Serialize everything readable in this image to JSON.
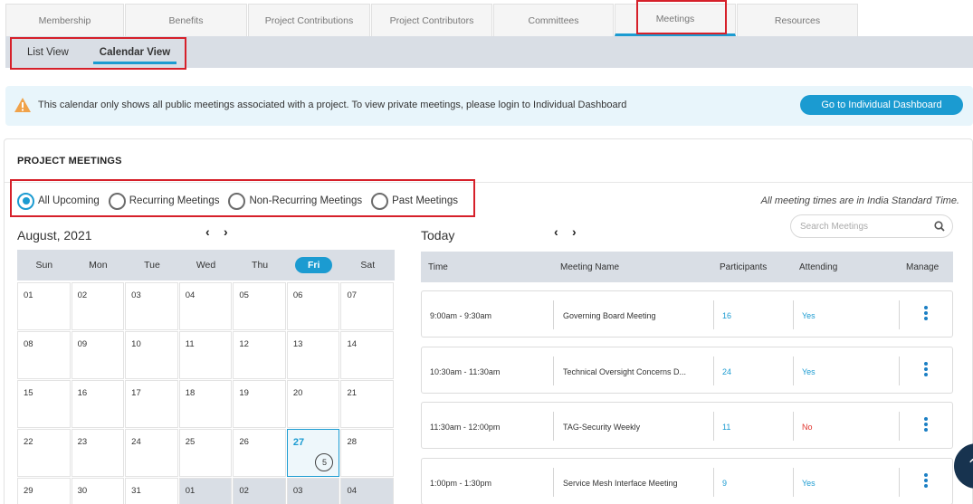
{
  "tabs": [
    "Membership",
    "Benefits",
    "Project Contributions",
    "Project Contributors",
    "Committees",
    "Meetings",
    "Resources"
  ],
  "active_tab": "Meetings",
  "subtabs": [
    "List View",
    "Calendar View"
  ],
  "active_subtab": "Calendar View",
  "alert": {
    "message": "This calendar only shows all public meetings associated with a project. To view private meetings, please login to Individual Dashboard",
    "button": "Go to Individual Dashboard"
  },
  "panel": {
    "title": "PROJECT MEETINGS",
    "filters": [
      "All Upcoming",
      "Recurring Meetings",
      "Non-Recurring Meetings",
      "Past Meetings"
    ],
    "selected_filter": "All Upcoming",
    "timezone_note": "All meeting times are in India Standard Time.",
    "search_placeholder": "Search Meetings"
  },
  "calendar": {
    "month": "August, 2021",
    "prev": "‹",
    "next": "›",
    "days": [
      "Sun",
      "Mon",
      "Tue",
      "Wed",
      "Thu",
      "Fri",
      "Sat"
    ],
    "today_day": "Fri",
    "weeks": [
      [
        "01",
        "02",
        "03",
        "04",
        "05",
        "06",
        "07"
      ],
      [
        "08",
        "09",
        "10",
        "11",
        "12",
        "13",
        "14"
      ],
      [
        "15",
        "16",
        "17",
        "18",
        "19",
        "20",
        "21"
      ],
      [
        "22",
        "23",
        "24",
        "25",
        "26",
        "27",
        "28"
      ],
      [
        "29",
        "30",
        "31",
        "01",
        "02",
        "03",
        "04"
      ]
    ],
    "today_date": "27",
    "today_count": "5"
  },
  "today": {
    "title": "Today",
    "columns": [
      "Time",
      "Meeting Name",
      "Participants",
      "Attending",
      "Manage"
    ],
    "meetings": [
      {
        "time": "9:00am - 9:30am",
        "name": "Governing Board Meeting",
        "participants": "16",
        "attending": "Yes"
      },
      {
        "time": "10:30am - 11:30am",
        "name": "Technical Oversight Concerns D...",
        "participants": "24",
        "attending": "Yes"
      },
      {
        "time": "11:30am - 12:00pm",
        "name": "TAG-Security Weekly",
        "participants": "11",
        "attending": "No"
      },
      {
        "time": "1:00pm - 1:30pm",
        "name": "Service Mesh Interface Meeting",
        "participants": "9",
        "attending": "Yes"
      }
    ]
  },
  "colors": {
    "accent": "#1b9bd1",
    "highlight": "#d6202a",
    "no": "#e0342d"
  }
}
